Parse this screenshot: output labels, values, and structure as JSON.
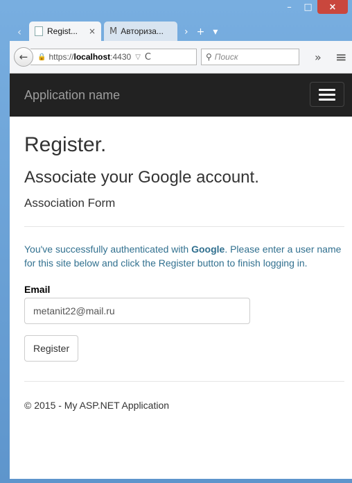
{
  "browser": {
    "tabs": [
      {
        "label": "Regist...",
        "close": "×"
      },
      {
        "label": "Авториза..."
      }
    ],
    "icons": {
      "tab_back": "‹",
      "tab_forward": "›",
      "new_tab": "+",
      "tab_list": "▾",
      "minimize": "–",
      "maximize": "□",
      "close": "×",
      "back": "←",
      "lock": "🔒",
      "dropdown": "▽",
      "reload": "C",
      "search": "🔍",
      "overflow": "»",
      "menu": "≡"
    },
    "url": {
      "prefix": "https://",
      "host": "localhost",
      "port": ":4430"
    },
    "search_placeholder": "Поиск"
  },
  "app": {
    "brand": "Application name"
  },
  "page": {
    "title": "Register.",
    "subtitle": "Associate your Google account.",
    "form_heading": "Association Form",
    "info_before": "You've successfully authenticated with ",
    "info_provider": "Google",
    "info_after": ". Please enter a user name for this site below and click the Register button to finish logging in.",
    "email_label": "Email",
    "email_value": "metanit22@mail.ru",
    "register_button": "Register",
    "footer": "© 2015 - My ASP.NET Application"
  }
}
